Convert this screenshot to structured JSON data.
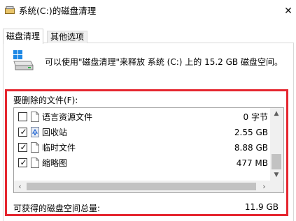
{
  "window": {
    "title": "系统(C:)的磁盘清理",
    "close_glyph": "✕"
  },
  "tabs": [
    {
      "label": "磁盘清理",
      "selected": true
    },
    {
      "label": "其他选项",
      "selected": false
    }
  ],
  "header": {
    "info_text": "可以使用\"磁盘清理\"来释放 系统 (C:) 上的 15.2 GB 磁盘空间。"
  },
  "files_section": {
    "label": "要删除的文件(F):",
    "items": [
      {
        "name": "语言资源文件",
        "size": "0 字节",
        "checked": false,
        "icon": "file-icon"
      },
      {
        "name": "回收站",
        "size": "2.55 GB",
        "checked": true,
        "icon": "recycle-bin-icon"
      },
      {
        "name": "临时文件",
        "size": "8.88 GB",
        "checked": true,
        "icon": "file-icon"
      },
      {
        "name": "缩略图",
        "size": "477 MB",
        "checked": true,
        "icon": "file-icon"
      }
    ]
  },
  "total": {
    "label": "可获得的磁盘空间总量:",
    "value": "11.9 GB"
  },
  "colors": {
    "highlight": "#e5262f",
    "border": "#a0a0a0",
    "scroll_thumb": "#c2c2c2"
  }
}
